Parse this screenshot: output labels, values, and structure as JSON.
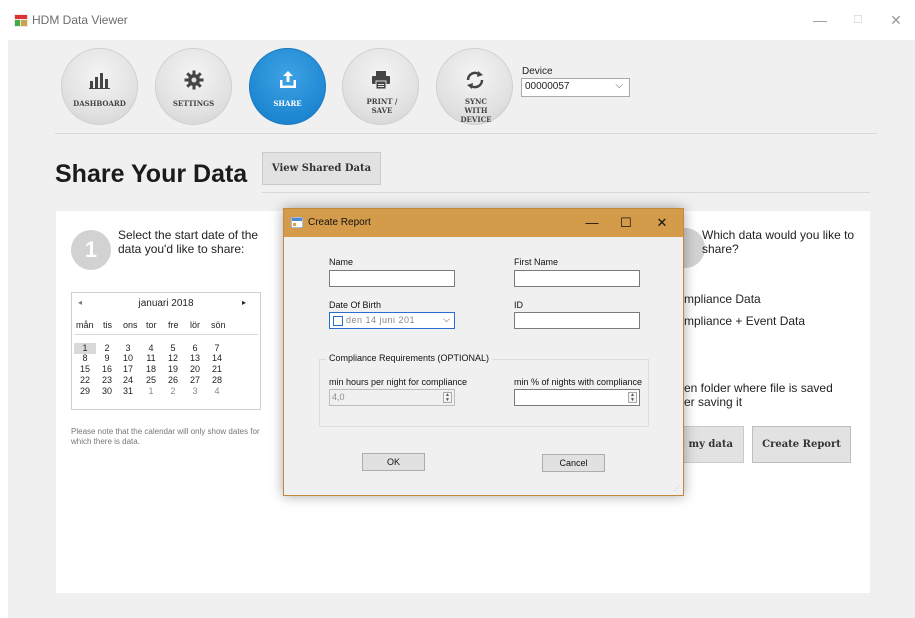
{
  "window": {
    "title": "HDM Data Viewer",
    "min": "—",
    "max": "☐",
    "close": "✕"
  },
  "nav": [
    {
      "label": "DASHBOARD",
      "icon": "bar-chart-icon"
    },
    {
      "label": "SETTINGS",
      "icon": "gear-icon"
    },
    {
      "label": "SHARE",
      "icon": "share-icon",
      "active": true
    },
    {
      "label": "PRINT / SAVE",
      "icon": "printer-icon"
    },
    {
      "label": "SYNC WITH DEVICE",
      "icon": "sync-icon"
    }
  ],
  "device": {
    "label": "Device",
    "value": "00000057"
  },
  "page": {
    "title": "Share Your Data",
    "view_shared": "View Shared Data"
  },
  "step1": {
    "number": "1",
    "text": "Select the start date of the data you'd like to share:",
    "note": "Please note that the calendar will only show dates for which there is data."
  },
  "calendar": {
    "month": "januari 2018",
    "prev": "◂",
    "next": "▸",
    "weekdays": [
      "mån",
      "tis",
      "ons",
      "tor",
      "fre",
      "lör",
      "sön"
    ],
    "weeks": [
      [
        "1",
        "2",
        "3",
        "4",
        "5",
        "6",
        "7"
      ],
      [
        "8",
        "9",
        "10",
        "11",
        "12",
        "13",
        "14"
      ],
      [
        "15",
        "16",
        "17",
        "18",
        "19",
        "20",
        "21"
      ],
      [
        "22",
        "23",
        "24",
        "25",
        "26",
        "27",
        "28"
      ],
      [
        "29",
        "30",
        "31",
        "1",
        "2",
        "3",
        "4"
      ]
    ],
    "selected": "1"
  },
  "step2": {
    "text": "Which data would you like to share?",
    "opt1": "mpliance Data",
    "opt2": "mpliance + Event Data",
    "open1": "en folder where file is saved",
    "open2": "er saving it",
    "email_btn": ": my data",
    "create_btn": "Create Report"
  },
  "dialog": {
    "title": "Create Report",
    "min": "—",
    "max": "☐",
    "close": "✕",
    "name_label": "Name",
    "first_name_label": "First Name",
    "dob_label": "Date Of Birth",
    "dob_value": "den 14    juni    201",
    "id_label": "ID",
    "group_title": "Compliance Requirements (OPTIONAL)",
    "min_hours_label": "min hours per night for compliance",
    "min_hours_value": "4,0",
    "min_pct_label": "min % of nights with compliance",
    "min_pct_value": "",
    "ok": "OK",
    "cancel": "Cancel"
  }
}
